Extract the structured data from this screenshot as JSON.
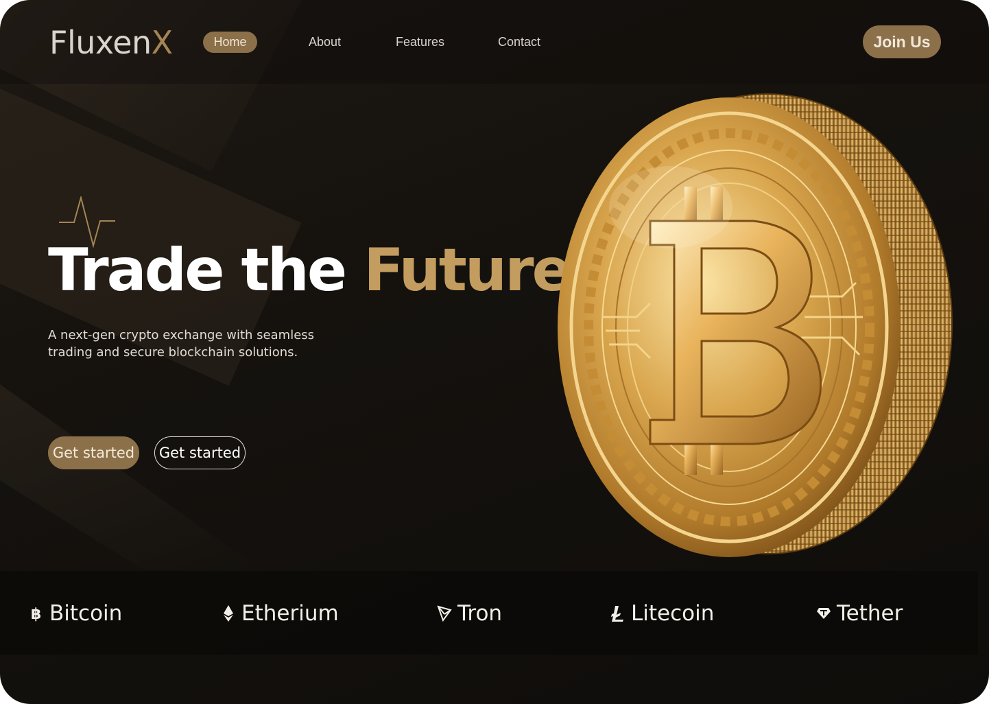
{
  "header": {
    "logo_main": "Fluxen",
    "logo_accent": "X",
    "nav": [
      {
        "label": "Home",
        "active": true
      },
      {
        "label": "About"
      },
      {
        "label": "Features"
      },
      {
        "label": "Contact"
      }
    ],
    "join_label": "Join Us"
  },
  "hero": {
    "headline_main": "Trade the",
    "headline_accent": "Future.",
    "subtitle": "A next-gen crypto exchange with seamless trading and secure blockchain solutions.",
    "cta_primary": "Get started",
    "cta_secondary": "Get started",
    "decor_icon": "pulse-line-icon",
    "image": "gold-bitcoin-coin"
  },
  "ticker": [
    {
      "icon": "bitcoin-icon",
      "label": "Bitcoin"
    },
    {
      "icon": "ethereum-icon",
      "label": "Etherium"
    },
    {
      "icon": "tron-icon",
      "label": "Tron"
    },
    {
      "icon": "litecoin-icon",
      "label": "Litecoin"
    },
    {
      "icon": "tether-icon",
      "label": "Tether"
    }
  ],
  "colors": {
    "accent": "#c39c5f",
    "button": "#8c7049",
    "background": "#15120e"
  }
}
